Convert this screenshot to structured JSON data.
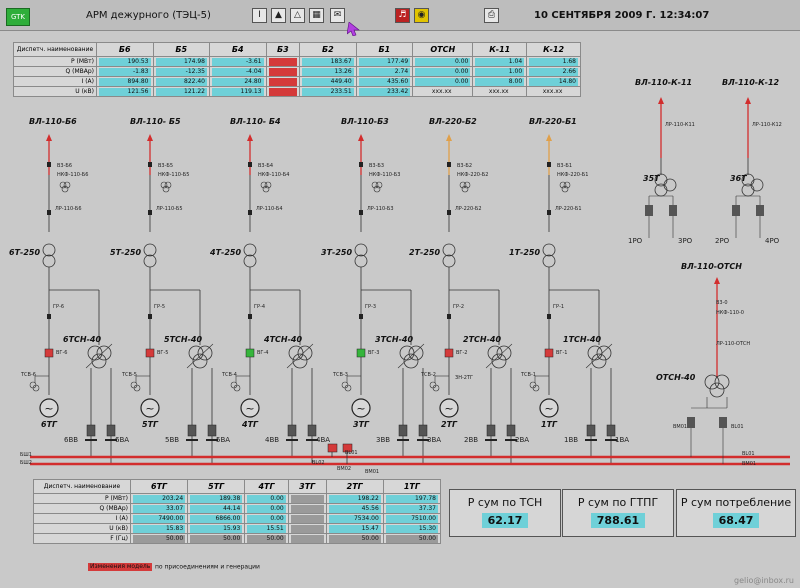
{
  "header": {
    "badge": "GTK",
    "title": "АРМ дежурного (ТЭЦ-5)",
    "datetime": "10 СЕНТЯБРЯ 2009 Г.  12:34:07",
    "toolbar": [
      "I",
      "",
      "",
      "",
      "",
      "",
      "",
      ""
    ]
  },
  "top_table": {
    "label": "Диспетч. наименование",
    "columns": [
      "Б6",
      "Б5",
      "Б4",
      "Б3",
      "Б2",
      "Б1",
      "ОТСН",
      "К-11",
      "К-12"
    ],
    "rows": [
      {
        "label": "P (МВт)",
        "cells": [
          {
            "v": "190.53",
            "c": "c"
          },
          {
            "v": "174.98",
            "c": "c"
          },
          {
            "v": "-3.61",
            "c": "c"
          },
          {
            "v": "",
            "c": "r"
          },
          {
            "v": "183.67",
            "c": "c"
          },
          {
            "v": "177.49",
            "c": "c"
          },
          {
            "v": "0.00",
            "c": "c"
          },
          {
            "v": "1.04",
            "c": "c"
          },
          {
            "v": "1.68",
            "c": "c"
          }
        ]
      },
      {
        "label": "Q (МВАр)",
        "cells": [
          {
            "v": "-1.83",
            "c": "c"
          },
          {
            "v": "-12.35",
            "c": "c"
          },
          {
            "v": "-4.04",
            "c": "c"
          },
          {
            "v": "",
            "c": "r"
          },
          {
            "v": "13.26",
            "c": "c"
          },
          {
            "v": "2.74",
            "c": "c"
          },
          {
            "v": "0.00",
            "c": "c"
          },
          {
            "v": "1.00",
            "c": "c"
          },
          {
            "v": "2.66",
            "c": "c"
          }
        ]
      },
      {
        "label": "I (А)",
        "cells": [
          {
            "v": "894.80",
            "c": "c"
          },
          {
            "v": "822.40",
            "c": "c"
          },
          {
            "v": "24.80",
            "c": "c"
          },
          {
            "v": "",
            "c": "r"
          },
          {
            "v": "449.40",
            "c": "c"
          },
          {
            "v": "435.60",
            "c": "c"
          },
          {
            "v": "0.00",
            "c": "c"
          },
          {
            "v": "8.00",
            "c": "c"
          },
          {
            "v": "14.80",
            "c": "c"
          }
        ]
      },
      {
        "label": "U (кВ)",
        "cells": [
          {
            "v": "121.56",
            "c": "c"
          },
          {
            "v": "121.22",
            "c": "c"
          },
          {
            "v": "119.13",
            "c": "c"
          },
          {
            "v": "",
            "c": "r"
          },
          {
            "v": "233.51",
            "c": "c"
          },
          {
            "v": "233.42",
            "c": "c"
          },
          {
            "v": "xxx.xx",
            "c": "p"
          },
          {
            "v": "xxx.xx",
            "c": "p"
          },
          {
            "v": "xxx.xx",
            "c": "p"
          }
        ]
      }
    ]
  },
  "bottom_table": {
    "label": "Диспетч. наименование",
    "columns": [
      "6ТГ",
      "5ТГ",
      "4ТГ",
      "3ТГ",
      "2ТГ",
      "1ТГ"
    ],
    "rows": [
      {
        "label": "P (МВт)",
        "cells": [
          {
            "v": "203.24",
            "c": "c"
          },
          {
            "v": "189.38",
            "c": "c"
          },
          {
            "v": "0.00",
            "c": "c"
          },
          {
            "v": "",
            "c": "g"
          },
          {
            "v": "198.22",
            "c": "c"
          },
          {
            "v": "197.78",
            "c": "c"
          }
        ]
      },
      {
        "label": "Q (МВАр)",
        "cells": [
          {
            "v": "33.07",
            "c": "c"
          },
          {
            "v": "44.14",
            "c": "c"
          },
          {
            "v": "0.00",
            "c": "c"
          },
          {
            "v": "",
            "c": "g"
          },
          {
            "v": "45.56",
            "c": "c"
          },
          {
            "v": "37.37",
            "c": "c"
          }
        ]
      },
      {
        "label": "I (А)",
        "cells": [
          {
            "v": "7490.00",
            "c": "c"
          },
          {
            "v": "6866.00",
            "c": "c"
          },
          {
            "v": "0.00",
            "c": "c"
          },
          {
            "v": "",
            "c": "g"
          },
          {
            "v": "7534.00",
            "c": "c"
          },
          {
            "v": "7510.00",
            "c": "c"
          }
        ]
      },
      {
        "label": "U (кВ)",
        "cells": [
          {
            "v": "15.83",
            "c": "c"
          },
          {
            "v": "15.93",
            "c": "c"
          },
          {
            "v": "15.51",
            "c": "c"
          },
          {
            "v": "",
            "c": "g"
          },
          {
            "v": "15.47",
            "c": "c"
          },
          {
            "v": "15.30",
            "c": "c"
          }
        ]
      },
      {
        "label": "F (Гц)",
        "cells": [
          {
            "v": "50.00",
            "c": "g"
          },
          {
            "v": "50.00",
            "c": "g"
          },
          {
            "v": "50.00",
            "c": "g"
          },
          {
            "v": "",
            "c": "g"
          },
          {
            "v": "50.00",
            "c": "g"
          },
          {
            "v": "50.00",
            "c": "g"
          }
        ]
      }
    ]
  },
  "summaries": [
    {
      "title": "Р сум по ТСН",
      "value": "62.17"
    },
    {
      "title": "Р сум по ГТПГ",
      "value": "788.61"
    },
    {
      "title": "Р сум потребление",
      "value": "68.47"
    }
  ],
  "legend": {
    "box": "Изменения модель",
    "text": "по присоединениям и генерации"
  },
  "watermark": "gelio@inbox.ru",
  "schematic": {
    "lines": [
      "ВЛ-110-Б6",
      "ВЛ-110- Б5",
      "ВЛ-110- Б4",
      "ВЛ-110-Б3",
      "ВЛ-220-Б2",
      "ВЛ-220-Б1"
    ],
    "line_switches": [
      "В3-Б6",
      "В3-Б5",
      "В3-Б4",
      "В3-Б3",
      "В3-Б2",
      "В3-Б1"
    ],
    "line_disconnectors": [
      "НКФ-110-Б6",
      "НКФ-110-Б5",
      "НКФ-110-Б4",
      "НКФ-110-Б3",
      "НКФ-220-Б2",
      "НКФ-220-Б1"
    ],
    "line_pr": [
      "ЛР-110-Б6",
      "ЛР-110-Б5",
      "ЛР-110-Б4",
      "ЛР-110-Б3",
      "ЛР-220-Б2",
      "ЛР-220-Б1"
    ],
    "block_tr": [
      "6Т-250",
      "5Т-250",
      "4Т-250",
      "3Т-250",
      "2Т-250",
      "1Т-250"
    ],
    "gr": [
      "ГР-6",
      "ГР-5",
      "ГР-4",
      "ГР-3",
      "ГР-2",
      "ГР-1"
    ],
    "tsn": [
      "6ТСН-40",
      "5ТСН-40",
      "4ТСН-40",
      "3ТСН-40",
      "2ТСН-40",
      "1ТСН-40"
    ],
    "vg": [
      "ВГ-6",
      "ВГ-5",
      "ВГ-4",
      "ВГ-3",
      "ВГ-2",
      "ВГ-1"
    ],
    "vg_state": [
      "red",
      "red",
      "green",
      "green",
      "red",
      "red"
    ],
    "tsv": [
      "ТСВ-6",
      "ТСВ-5",
      "ТСВ-4",
      "ТСВ-3",
      "ТСВ-2",
      "ТСВ-1"
    ],
    "gens": [
      "6ТГ",
      "5ТГ",
      "4ТГ",
      "3ТГ",
      "2ТГ",
      "1ТГ"
    ],
    "sec_a": [
      "6ВВ",
      "5ВВ",
      "4ВВ",
      "3ВВ",
      "2ВВ",
      "1ВВ"
    ],
    "sec_b": [
      "6ВА",
      "5ВА",
      "4ВА",
      "3ВА",
      "2ВА",
      "1ВА"
    ],
    "extra": "ЗН-2ТГ",
    "buses": [
      "БШ1",
      "БШ2",
      "BL02",
      "BL01",
      "ВМ02",
      "ВМ01",
      "ВМ01",
      "ВМ01",
      "BL01"
    ],
    "bl_labels": [
      "ВЛ-110-К-11",
      "ВЛ-110-К-12",
      "ВЛ-110-ОТСН"
    ],
    "k_pr": [
      "ЛР-110-К11",
      "ЛР-110-К12"
    ],
    "k_tr": [
      "35Т",
      "36Т"
    ],
    "ro": [
      "1РО",
      "3РО",
      "2РО",
      "4РО"
    ],
    "otsn_sw": [
      "В3-0",
      "НКФ-110-0",
      "ЛР-110-ОТСН"
    ],
    "otsn_tr": "ОТСН-40",
    "otsn_bus": [
      "ВМ01",
      "BL01"
    ]
  },
  "colors": {
    "cyan": "#6fd0d8",
    "red": "#d43a3a",
    "green": "#35b53b",
    "bus": "#d22d2d"
  }
}
